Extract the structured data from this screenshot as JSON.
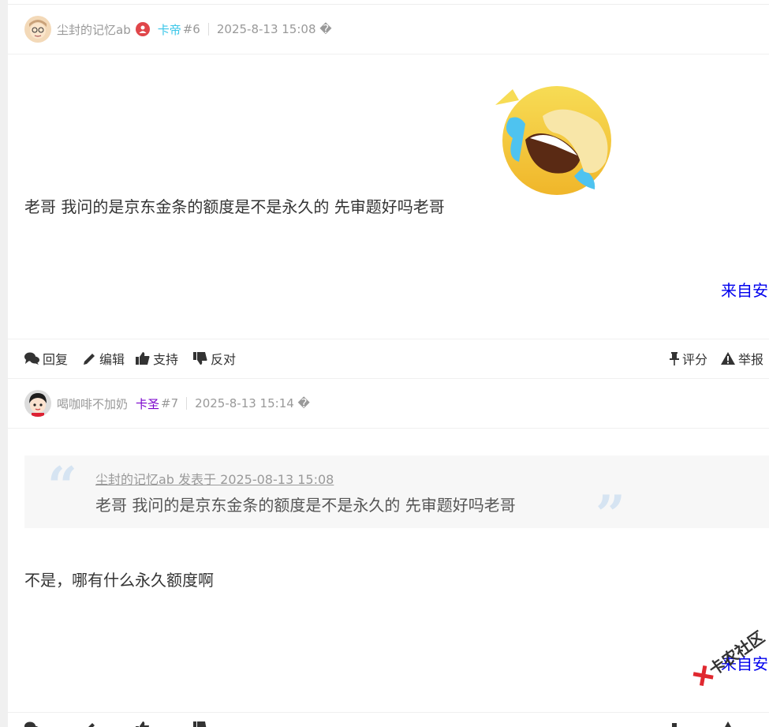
{
  "post6": {
    "username": "尘封的记忆ab",
    "rank": "卡帝",
    "rank_color": "#3ac6e8",
    "floor": "#6",
    "time": "2025-8-13 15:08 �",
    "content": "老哥 我问的是京东金条的额度是不是永久的 先审题好吗老哥",
    "emoji": "laughing-crying-emoji",
    "from": "来自安",
    "actions": {
      "reply": "回复",
      "edit": "编辑",
      "support": "支持",
      "oppose": "反对",
      "rate": "评分",
      "report": "举报"
    }
  },
  "post7": {
    "username": "喝咖啡不加奶",
    "rank": "卡圣",
    "rank_color": "#7a00cc",
    "floor": "#7",
    "time": "2025-8-13 15:14 �",
    "quote": {
      "author": "尘封的记忆ab 发表于 2025-08-13 15:08",
      "text": "老哥 我问的是京东金条的额度是不是永久的 先审题好吗老哥",
      "open_mark": "“",
      "close_mark": "”"
    },
    "content": "不是，哪有什么永久额度啊",
    "from": "来自安"
  },
  "watermark": {
    "text": "卡农社区"
  },
  "colors": {
    "link": "#0000ee",
    "meta": "#999999",
    "quote_mark": "#d6e4f2"
  }
}
